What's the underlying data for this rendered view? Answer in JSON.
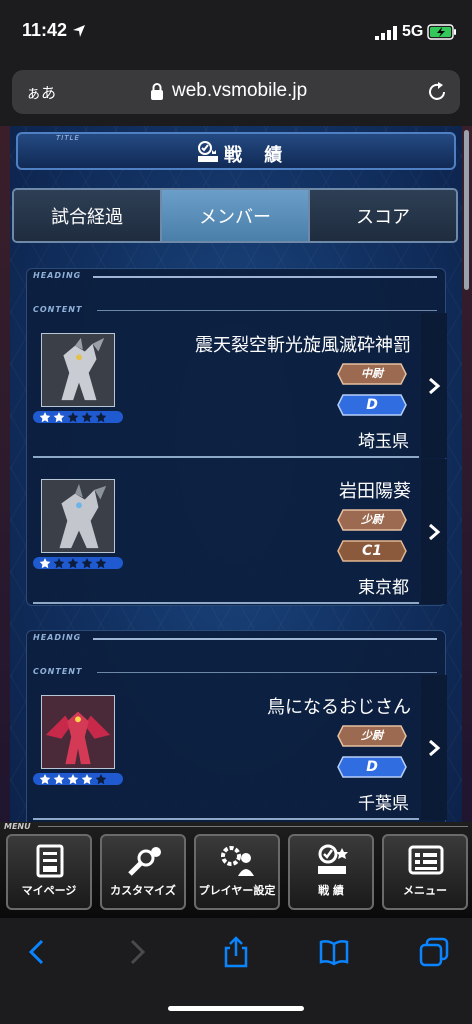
{
  "status": {
    "time": "11:42",
    "network": "5G"
  },
  "browser": {
    "text_size": "ぁあ",
    "url": "web.vsmobile.jp"
  },
  "page": {
    "title_tag": "TITLE",
    "title": "戦 績",
    "tabs": [
      {
        "label": "試合経過",
        "active": false
      },
      {
        "label": "メンバー",
        "active": true
      },
      {
        "label": "スコア",
        "active": false
      }
    ],
    "section_heading": "HEADING",
    "section_content": "CONTENT",
    "teams": [
      {
        "members": [
          {
            "name": "震天裂空斬光旋風滅砕神罰",
            "rank": "中尉",
            "grade": "D",
            "prefecture": "埼玉県",
            "stars": 2
          },
          {
            "name": "岩田陽葵",
            "rank": "少尉",
            "grade": "C1",
            "prefecture": "東京都",
            "stars": 1
          }
        ]
      },
      {
        "members": [
          {
            "name": "鳥になるおじさん",
            "rank": "少尉",
            "grade": "D",
            "prefecture": "千葉県",
            "stars": 4
          }
        ]
      }
    ]
  },
  "menu": {
    "tag": "MENU",
    "items": [
      {
        "label": "マイページ",
        "icon": "mypage-icon"
      },
      {
        "label": "カスタマイズ",
        "icon": "customize-icon"
      },
      {
        "label": "プレイヤー設定",
        "icon": "player-settings-icon"
      },
      {
        "label": "戦 績",
        "icon": "records-icon"
      },
      {
        "label": "メニュー",
        "icon": "menu-icon"
      }
    ]
  },
  "colors": {
    "tab_active": "#5a8fbb",
    "grade_blue": "#2f6de0",
    "rank_bronze": "#a0674a",
    "grade_gold": "#8b5a3c"
  }
}
